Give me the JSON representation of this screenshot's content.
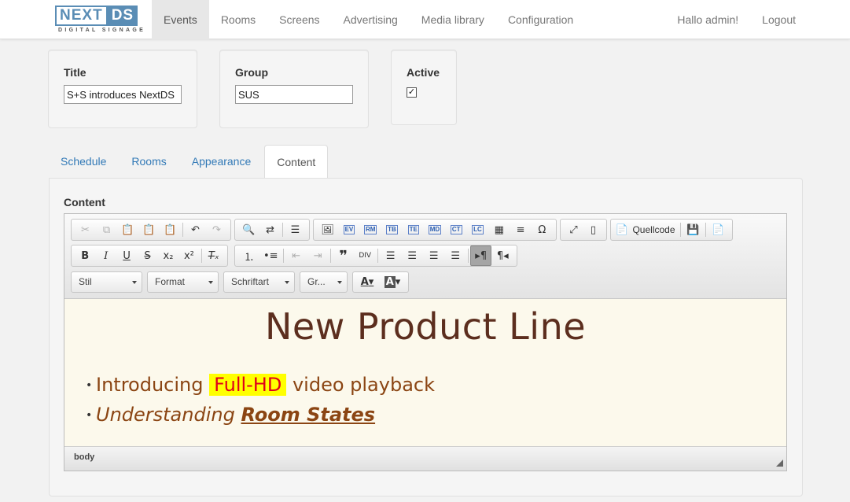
{
  "brand": {
    "name_a": "NEXT",
    "name_b": "DS",
    "tagline": "DIGITAL SIGNAGE",
    "color": "#5a8db5"
  },
  "nav": {
    "items": [
      {
        "label": "Events",
        "active": true
      },
      {
        "label": "Rooms"
      },
      {
        "label": "Screens"
      },
      {
        "label": "Advertising"
      },
      {
        "label": "Media library"
      },
      {
        "label": "Configuration"
      }
    ],
    "greeting": "Hallo admin!",
    "logout": "Logout"
  },
  "form": {
    "title_label": "Title",
    "title_value": "S+S introduces NextDS",
    "group_label": "Group",
    "group_value": "SUS",
    "active_label": "Active",
    "active_checked": true
  },
  "tabs": [
    {
      "label": "Schedule"
    },
    {
      "label": "Rooms"
    },
    {
      "label": "Appearance"
    },
    {
      "label": "Content",
      "active": true
    }
  ],
  "content_panel": {
    "label": "Content"
  },
  "editor": {
    "toolbar": {
      "ev": "EV",
      "rm": "RM",
      "tb": "TB",
      "te": "TE",
      "md": "MD",
      "ct": "CT",
      "lc": "LC",
      "source_label": "Quellcode",
      "bold": "B",
      "italic": "I",
      "underline": "U",
      "strike": "S",
      "style_combo": "Stil",
      "format_combo": "Format",
      "font_combo": "Schriftart",
      "size_combo": "Gr...",
      "text_color": "A",
      "bg_color": "A"
    },
    "doc": {
      "heading": "New Product Line",
      "item1_pre": "Introducing ",
      "item1_hl": "Full-HD",
      "item1_post": " video playback",
      "item2_pre": "Understanding ",
      "item2_em": "Room States"
    },
    "status_path": "body"
  },
  "colors": {
    "heading": "#5c2e1e",
    "text": "#8b4513",
    "highlight_bg": "#ffff00",
    "highlight_fg": "#e0001a",
    "content_bg": "#fcf9ec"
  }
}
